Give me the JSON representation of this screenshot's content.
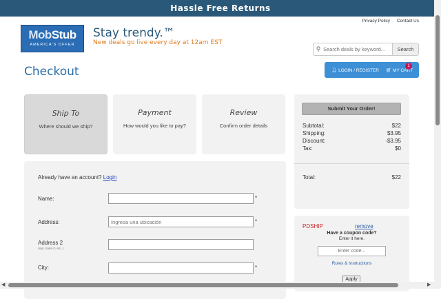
{
  "banner": {
    "text": "Hassle Free Returns"
  },
  "top_links": {
    "privacy": "Privacy Policy",
    "contact": "Contact Us"
  },
  "logo": {
    "name_part1": "Mob",
    "name_part2": "Stub",
    "tagline": "AMERICA'S OFFER"
  },
  "header": {
    "tagline": "Stay trendy.™",
    "subtagline": "New deals go live every day at 12am EST"
  },
  "search": {
    "placeholder": "Search deals by keyword...",
    "button_label": "Search",
    "icon": "search-icon"
  },
  "page_title": "Checkout",
  "account_bar": {
    "login_label": "LOGIN / REGISTER",
    "cart_label": "MY CART",
    "cart_count": "1",
    "accent": "#3d8fd6"
  },
  "steps": [
    {
      "title": "Ship To",
      "desc": "Where should we ship?"
    },
    {
      "title": "Payment",
      "desc": "How would you like to pay?"
    },
    {
      "title": "Review",
      "desc": "Confirm order details"
    }
  ],
  "summary": {
    "submit_label": "Submit Your Order!",
    "rows": [
      {
        "label": "Subtotal:",
        "value": "$22"
      },
      {
        "label": "Shipping:",
        "value": "$3.95"
      },
      {
        "label": "Discount:",
        "value": "-$3.95"
      },
      {
        "label": "Tax:",
        "value": "$0"
      }
    ],
    "total_label": "Total:",
    "total_value": "$22"
  },
  "coupon": {
    "applied_code": "PDSHIP",
    "remove_label": "remove",
    "question": "Have a coupon code?",
    "instruction": "Enter it here.",
    "placeholder": "Enter code...",
    "rules_label": "Rules & Instructions",
    "apply_label": "Apply"
  },
  "form": {
    "account_prompt": "Already have an account?",
    "login_link": "Login",
    "fields": {
      "name": {
        "label": "Name:",
        "value": "",
        "required": "*"
      },
      "address": {
        "label": "Address:",
        "placeholder": "Ingresa una ubicación",
        "required": "*"
      },
      "address2": {
        "label": "Address 2",
        "hint": "(Apt, Suite #, etc..)",
        "value": ""
      },
      "city": {
        "label": "City:",
        "value": "",
        "required": "*"
      }
    }
  },
  "colors": {
    "banner": "#2a5878",
    "title_blue": "#2a6da8",
    "brand_orange": "#e07b1f",
    "coupon_red": "#c62828"
  }
}
